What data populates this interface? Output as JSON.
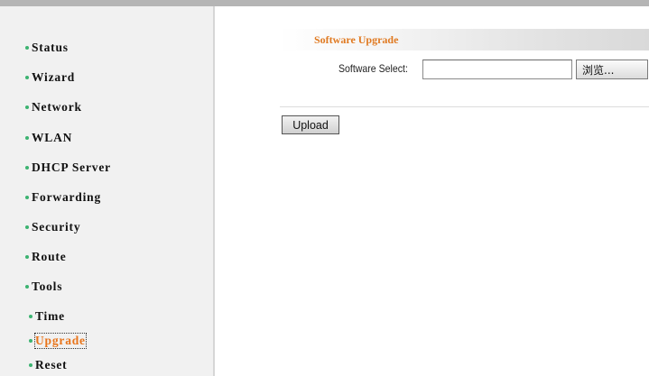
{
  "colors": {
    "bullet": "#3cb371",
    "accent": "#e07a22",
    "sidebar_bg": "#f1f1f1"
  },
  "sidebar": {
    "items": [
      {
        "label": "Status"
      },
      {
        "label": "Wizard"
      },
      {
        "label": "Network"
      },
      {
        "label": "WLAN"
      },
      {
        "label": "DHCP Server"
      },
      {
        "label": "Forwarding"
      },
      {
        "label": "Security"
      },
      {
        "label": "Route"
      },
      {
        "label": "Tools"
      }
    ],
    "sub_items": [
      {
        "label": "Time"
      },
      {
        "label": "Upgrade",
        "active": true
      },
      {
        "label": "Reset"
      }
    ]
  },
  "main": {
    "section_title": "Software Upgrade",
    "software_select_label": "Software Select:",
    "file_input_value": "",
    "browse_label": "浏览...",
    "upload_label": "Upload"
  }
}
